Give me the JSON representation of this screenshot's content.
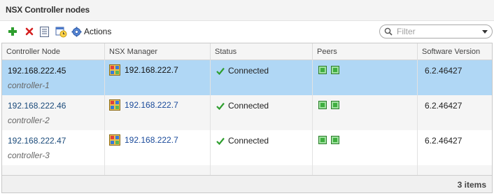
{
  "panel": {
    "title": "NSX Controller nodes"
  },
  "toolbar": {
    "actions_label": "Actions",
    "icons": [
      "add-icon",
      "delete-icon",
      "document-icon",
      "schedule-icon",
      "gear-icon"
    ],
    "accent_add": "#2e9e2e",
    "accent_delete": "#d42020"
  },
  "filter": {
    "placeholder": "Filter"
  },
  "table": {
    "columns": [
      "Controller Node",
      "NSX Manager",
      "Status",
      "Peers",
      "Software Version"
    ],
    "rows": [
      {
        "ip": "192.168.222.45",
        "name": "controller-1",
        "manager": "192.168.222.7",
        "status": "Connected",
        "version": "6.2.46427",
        "selected": true
      },
      {
        "ip": "192.168.222.46",
        "name": "controller-2",
        "manager": "192.168.222.7",
        "status": "Connected",
        "version": "6.2.46427",
        "selected": false
      },
      {
        "ip": "192.168.222.47",
        "name": "controller-3",
        "manager": "192.168.222.7",
        "status": "Connected",
        "version": "6.2.46427",
        "selected": false
      }
    ],
    "selected_color": "#b0d7f5",
    "peer_color": "#3fae3f"
  },
  "footer": {
    "count": "3 items"
  }
}
